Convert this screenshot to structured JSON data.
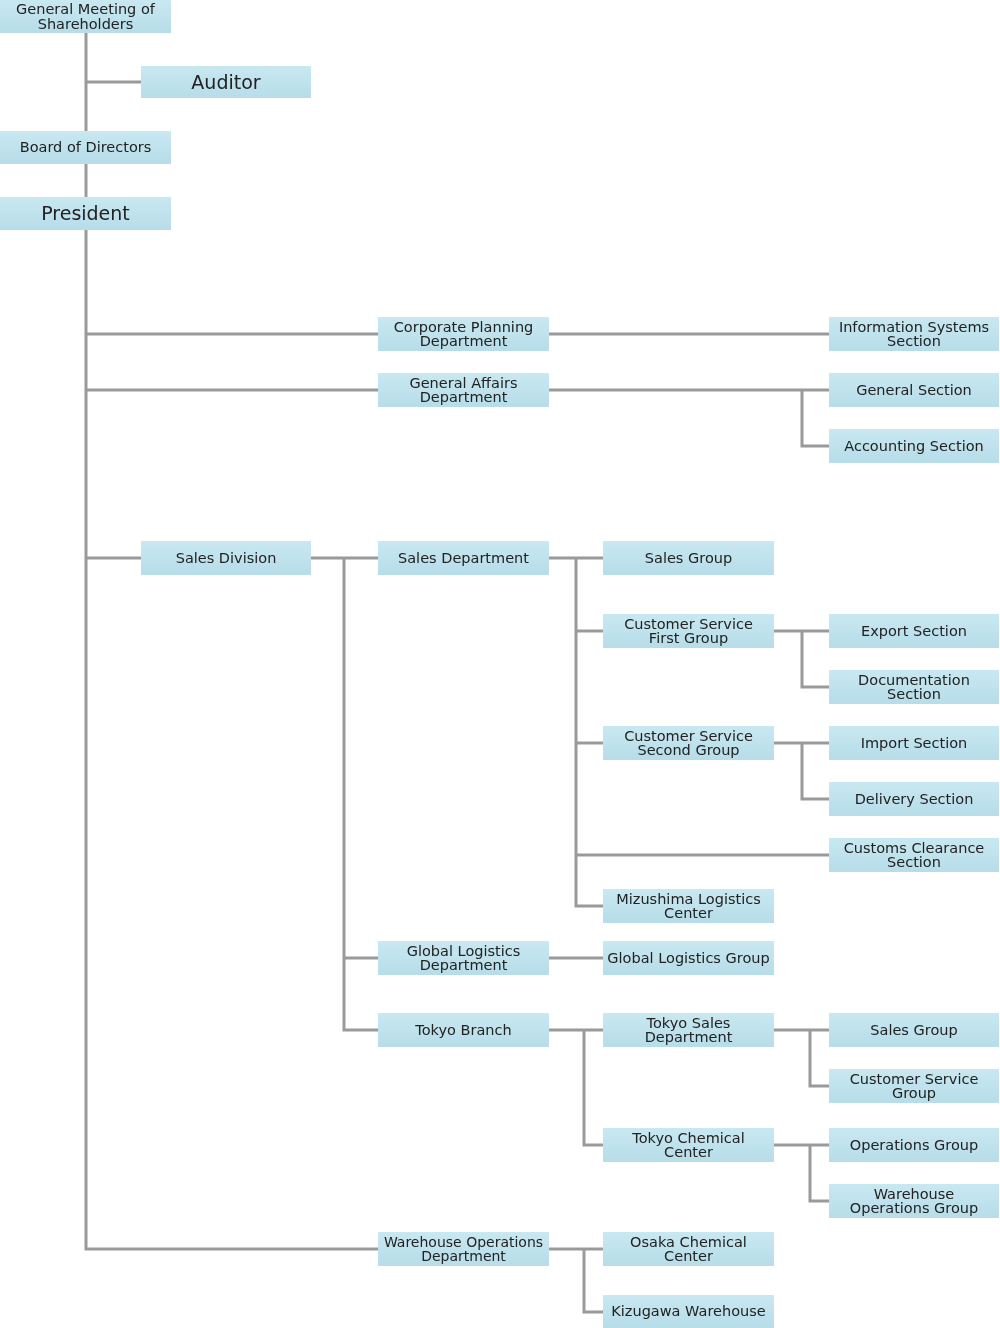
{
  "org_chart": {
    "root": {
      "label": "General Meeting of Shareholders",
      "children": [
        {
          "label": "Auditor"
        },
        {
          "label": "Board of Directors",
          "children": [
            {
              "label": "President",
              "children": [
                {
                  "label": "Corporate Planning Department",
                  "children": [
                    {
                      "label": "Information Systems Section"
                    }
                  ]
                },
                {
                  "label": "General Affairs Department",
                  "children": [
                    {
                      "label": "General Section"
                    },
                    {
                      "label": "Accounting Section"
                    }
                  ]
                },
                {
                  "label": "Sales Division",
                  "children": [
                    {
                      "label": "Sales Department",
                      "children": [
                        {
                          "label": "Sales Group"
                        },
                        {
                          "label": "Customer Service First Group",
                          "children": [
                            {
                              "label": "Export Section"
                            },
                            {
                              "label": "Documentation Section"
                            }
                          ]
                        },
                        {
                          "label": "Customer Service Second Group",
                          "children": [
                            {
                              "label": "Import Section"
                            },
                            {
                              "label": "Delivery Section"
                            }
                          ]
                        },
                        {
                          "label": "Customs Clearance Section"
                        },
                        {
                          "label": "Mizushima Logistics Center"
                        }
                      ]
                    },
                    {
                      "label": "Global Logistics Department",
                      "children": [
                        {
                          "label": "Global Logistics Group"
                        }
                      ]
                    },
                    {
                      "label": "Tokyo Branch",
                      "children": [
                        {
                          "label": "Tokyo Sales Department",
                          "children": [
                            {
                              "label": "Sales Group"
                            },
                            {
                              "label": "Customer Service Group"
                            }
                          ]
                        },
                        {
                          "label": "Tokyo Chemical Center",
                          "children": [
                            {
                              "label": "Operations Group"
                            },
                            {
                              "label": "Warehouse Operations Group"
                            }
                          ]
                        }
                      ]
                    }
                  ]
                },
                {
                  "label": "Warehouse Operations Department",
                  "children": [
                    {
                      "label": "Osaka Chemical Center"
                    },
                    {
                      "label": "Kizugawa Warehouse"
                    }
                  ]
                }
              ]
            }
          ]
        }
      ]
    }
  }
}
